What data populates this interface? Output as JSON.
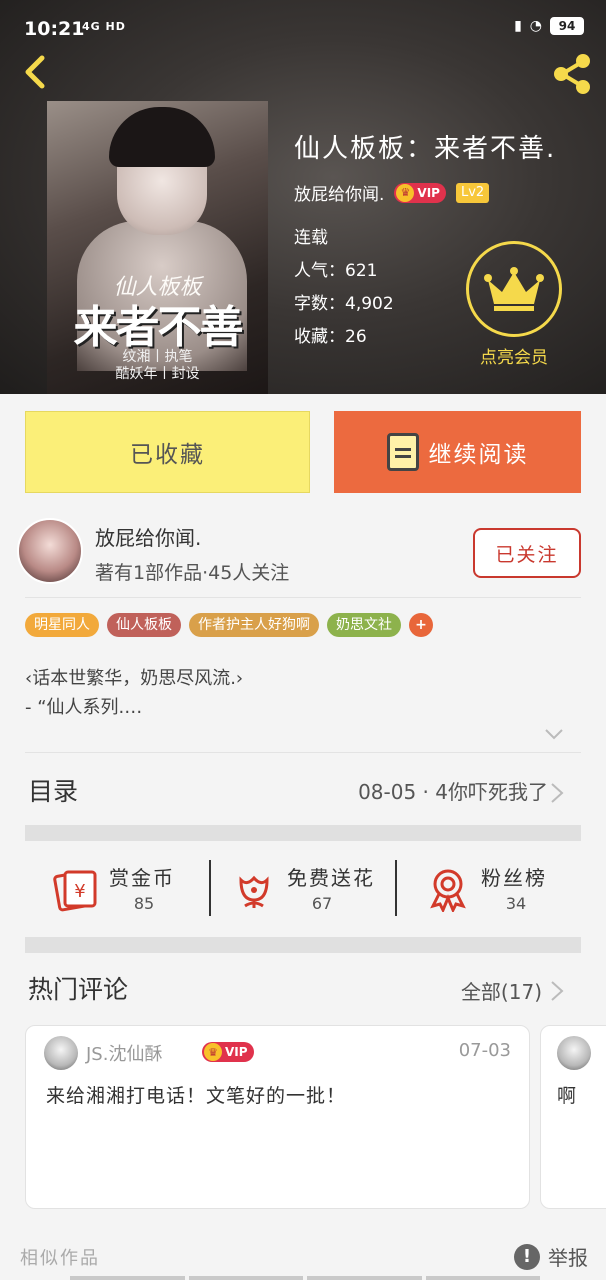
{
  "status_bar": {
    "time": "10:21",
    "network": "4G HD",
    "battery": "94"
  },
  "book": {
    "title": "仙人板板：来者不善.",
    "author": "放屁给你闻.",
    "vip": "VIP",
    "level": "Lv2",
    "status": "连载",
    "popularity": "人气：621",
    "word_count": "字数：4,902",
    "favorites": "收藏：26",
    "member_label": "点亮会员",
    "cover_text": {
      "line1": "仙人板板",
      "line2": "来者不善",
      "line3": "纹湘丨执笔",
      "line4": "酷妖年丨封设"
    }
  },
  "actions": {
    "collected": "已收藏",
    "continue_reading": "继续阅读"
  },
  "author": {
    "name": "放屁给你闻.",
    "works": "著有1部作品·45人关注",
    "follow": "已关注"
  },
  "tags": [
    {
      "label": "明星同人",
      "color": "#f2a93b"
    },
    {
      "label": "仙人板板",
      "color": "#c0615a"
    },
    {
      "label": "作者护主人好狗啊",
      "color": "#d9a04a"
    },
    {
      "label": "奶思文社",
      "color": "#8db24c"
    },
    {
      "label": "+",
      "color": "#e8663a"
    }
  ],
  "intro": {
    "line1": "‹话本世繁华，奶思尽风流.›",
    "line2": "- “仙人系列.…"
  },
  "catalog": {
    "label": "目录",
    "latest": "08-05 · 4你吓死我了"
  },
  "stats": [
    {
      "label": "赏金币",
      "value": "85",
      "icon": "gold-coin-icon"
    },
    {
      "label": "免费送花",
      "value": "67",
      "icon": "flower-icon"
    },
    {
      "label": "粉丝榜",
      "value": "34",
      "icon": "medal-icon"
    }
  ],
  "comments": {
    "label": "热门评论",
    "all": "全部(17)",
    "items": [
      {
        "user": "JS.沈仙酥",
        "vip": "VIP",
        "date": "07-03",
        "text": "来给湘湘打电话！文笔好的一批！"
      },
      {
        "text": "啊"
      }
    ]
  },
  "footer": {
    "similar": "相似作品",
    "report": "举报"
  }
}
